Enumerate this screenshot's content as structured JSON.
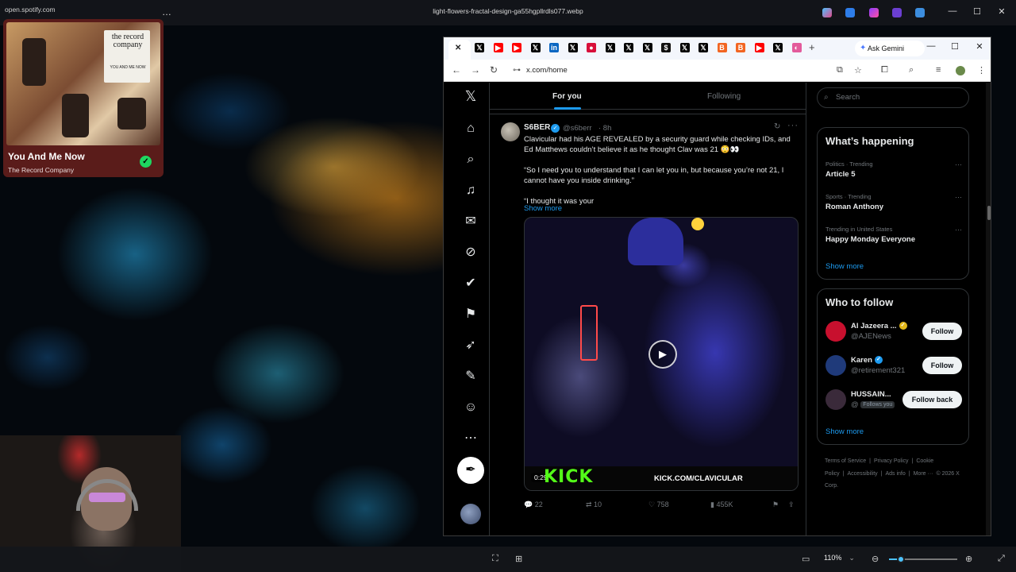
{
  "os": {
    "window_title": "light-flowers-fractal-design-ga55hgpllrdls077.webp",
    "controls": {
      "minimize": "—",
      "maximize": "☐",
      "close": "✕"
    },
    "more_glyph": "…"
  },
  "pip": {
    "url": "open.spotify.com",
    "track_title": "You And Me Now",
    "artist": "The Record Company",
    "saved_glyph": "✓",
    "album_art": {
      "title": "the record company",
      "subtitle": "YOU AND ME NOW"
    }
  },
  "viewer": {
    "zoom": "110%",
    "zoom_level": 0.18,
    "icons": [
      "crop-icon",
      "text-select-icon",
      "fit-icon",
      "zoom-out-icon",
      "zoom-in-icon",
      "expand-icon"
    ]
  },
  "browser": {
    "tab_close": "✕",
    "new_tab": "+",
    "ask_gemini": "Ask Gemini",
    "url": "x.com/home",
    "tabs": [
      {
        "icon": "x-logo-icon",
        "glyph": "𝕏",
        "color": "#000000"
      },
      {
        "icon": "youtube-icon",
        "glyph": "▶",
        "color": "#ff0000"
      },
      {
        "icon": "youtube-icon",
        "glyph": "▶",
        "color": "#ff0000"
      },
      {
        "icon": "x-logo-icon",
        "glyph": "𝕏",
        "color": "#000000"
      },
      {
        "icon": "linkedin-icon",
        "glyph": "in",
        "color": "#0a66c2"
      },
      {
        "icon": "x-logo-icon",
        "glyph": "𝕏",
        "color": "#000000"
      },
      {
        "icon": "shield-red-icon",
        "glyph": "●",
        "color": "#d80f3a"
      },
      {
        "icon": "x-logo-icon",
        "glyph": "𝕏",
        "color": "#000000"
      },
      {
        "icon": "x-logo-icon",
        "glyph": "𝕏",
        "color": "#000000"
      },
      {
        "icon": "x-logo-icon",
        "glyph": "𝕏",
        "color": "#000000"
      },
      {
        "icon": "dollar-icon",
        "glyph": "$",
        "color": "#111111"
      },
      {
        "icon": "x-logo-icon",
        "glyph": "𝕏",
        "color": "#000000"
      },
      {
        "icon": "x-logo-icon",
        "glyph": "𝕏",
        "color": "#000000"
      },
      {
        "icon": "b-icon",
        "glyph": "B",
        "color": "#f26522"
      },
      {
        "icon": "b-icon",
        "glyph": "B",
        "color": "#f26522"
      },
      {
        "icon": "youtube-icon",
        "glyph": "▶",
        "color": "#ff0000"
      },
      {
        "icon": "x-logo-icon",
        "glyph": "𝕏",
        "color": "#000000"
      },
      {
        "icon": "extension-icon",
        "glyph": "◐",
        "color": "#e35a9b"
      }
    ]
  },
  "x": {
    "feed_tabs": {
      "for_you": "For you",
      "following": "Following"
    },
    "tweet": {
      "name": "S6BER",
      "handle": "@s6berr",
      "time": "· 8h",
      "paragraphs": [
        "Clavicular had his AGE REVEALED by a security guard while checking IDs, and Ed Matthews couldn’t believe it as he thought Clav was 21 😳👀",
        "“So I need you to understand that I can let you in, but because you’re not 21, I cannot have you inside drinking.”",
        "“I thought it was your"
      ],
      "show_more": "Show more",
      "video": {
        "duration": "0:29",
        "watermark": "KICK",
        "watermark_url": "KICK.COM/CLAVICULAR"
      },
      "stats": {
        "replies": "22",
        "reposts": "10",
        "likes": "758",
        "views": "455K"
      }
    },
    "search_placeholder": "Search",
    "whats_happening": {
      "title": "What’s happening",
      "trends": [
        {
          "meta": "Politics · Trending",
          "name": "Article 5"
        },
        {
          "meta": "Sports · Trending",
          "name": "Roman Anthony"
        },
        {
          "meta": "Trending in United States",
          "name": "Happy Monday Everyone"
        }
      ],
      "show_more": "Show more"
    },
    "who_to_follow": {
      "title": "Who to follow",
      "accounts": [
        {
          "name": "Al Jazeera ...",
          "handle": "@AJENews",
          "button": "Follow",
          "badge_color": "#e2b719",
          "avatar_color": "#c8102e"
        },
        {
          "name": "Karen",
          "handle": "@retirement321",
          "button": "Follow",
          "badge_color": "#1d9bf0",
          "avatar_color": "#1f3a7a"
        },
        {
          "name": "HUSSAIN...",
          "handle": "@",
          "follows_you": "Follows you",
          "button": "Follow back",
          "avatar_color": "#3a2a3a"
        }
      ],
      "show_more": "Show more"
    },
    "footer": [
      "Terms of Service",
      "|",
      "Privacy Policy",
      "|",
      "Cookie Policy",
      "|",
      "Accessibility",
      "|",
      "Ads info",
      "|",
      "More ···",
      "© 2026 X Corp."
    ]
  }
}
